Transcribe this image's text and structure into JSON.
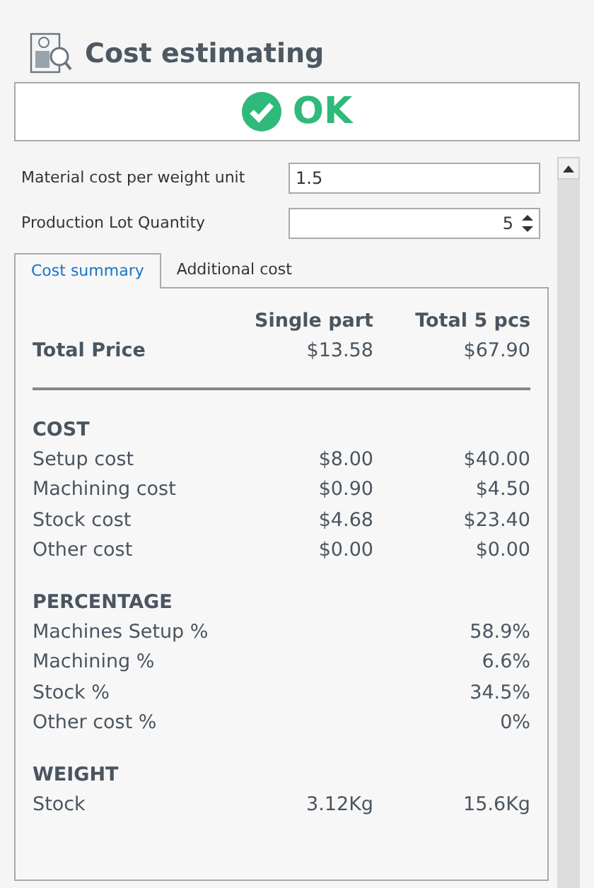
{
  "header": {
    "title": "Cost estimating"
  },
  "status": {
    "kind": "ok",
    "label": "OK"
  },
  "fields": [
    {
      "label": "Material cost per weight unit",
      "value": "1.5",
      "kind": "text"
    },
    {
      "label": "Production Lot Quantity",
      "value": "5",
      "kind": "spinner"
    }
  ],
  "tabs": [
    {
      "label": "Cost summary",
      "selected": true
    },
    {
      "label": "Additional cost",
      "selected": false
    }
  ],
  "summary": {
    "columns": [
      "Single part",
      "Total 5 pcs"
    ],
    "total": {
      "label": "Total Price",
      "single": "$13.58",
      "total": "$67.90"
    },
    "sections": [
      {
        "title": "COST",
        "rows": [
          {
            "label": "Setup cost",
            "single": "$8.00",
            "total": "$40.00"
          },
          {
            "label": "Machining cost",
            "single": "$0.90",
            "total": "$4.50"
          },
          {
            "label": "Stock cost",
            "single": "$4.68",
            "total": "$23.40"
          },
          {
            "label": "Other cost",
            "single": "$0.00",
            "total": "$0.00"
          }
        ]
      },
      {
        "title": "PERCENTAGE",
        "rows": [
          {
            "label": "Machines Setup %",
            "total": "58.9%"
          },
          {
            "label": "Machining %",
            "total": "6.6%"
          },
          {
            "label": "Stock %",
            "total": "34.5%"
          },
          {
            "label": "Other cost %",
            "total": "0%"
          }
        ]
      },
      {
        "title": "WEIGHT",
        "rows": [
          {
            "label": "Stock",
            "single": "3.12Kg",
            "total": "15.6Kg"
          }
        ]
      }
    ]
  }
}
